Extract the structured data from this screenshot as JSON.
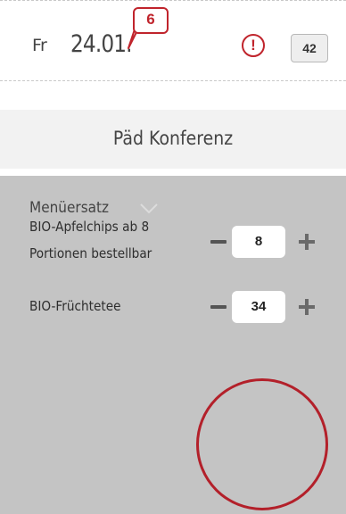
{
  "date_row": {
    "day": "Fr",
    "date": "24.01.",
    "notification_count": "6",
    "alert_symbol": "!",
    "count_badge": "42"
  },
  "header": {
    "title": "Päd Konferenz"
  },
  "panel": {
    "menu_select_label": "Menüersatz",
    "items": [
      {
        "label_line1": "BIO-Apfelchips ab 8",
        "label_line2": "Portionen bestellbar",
        "quantity": "8"
      },
      {
        "label_line1": "BIO-Früchtetee",
        "quantity": "34"
      }
    ]
  },
  "colors": {
    "accent_red": "#c0242c",
    "panel_gray": "#c4c4c4",
    "header_gray": "#f2f2f2"
  },
  "icons": {
    "alert": "exclamation-circle-icon",
    "chevron": "chevron-down-icon",
    "minus": "minus-icon",
    "plus": "plus-icon"
  }
}
